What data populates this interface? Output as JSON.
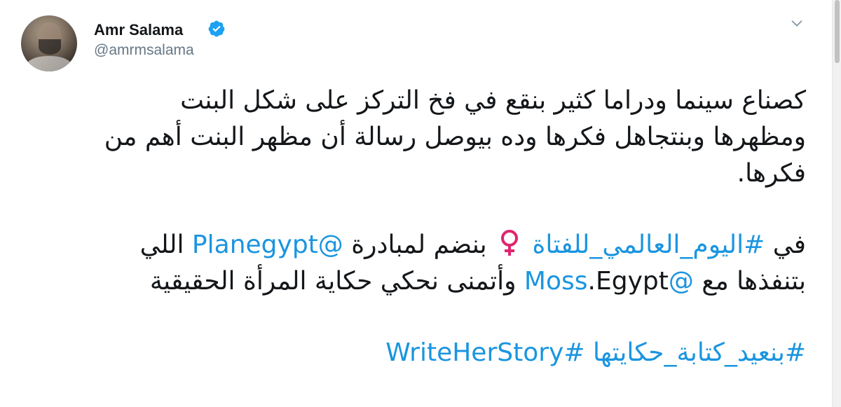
{
  "tweet": {
    "author": {
      "display_name": "Amr Salama",
      "handle": "@amrmsalama",
      "verified": true,
      "avatar_icon": "avatar-photo"
    },
    "menu_icon": "chevron-down-icon",
    "paragraph1_line1": "كصناع سينما ودراما كثير بنقع في فخ التركز على شكل البنت",
    "paragraph1_line2": "ومظهرها وبنتجاهل فكرها وده بيوصل رسالة أن مظهر البنت أهم من",
    "paragraph1_line3": "فكرها.",
    "p2_in": "في",
    "p2_hashtag": "#اليوم_العالمي_للفتاة",
    "p2_mid": "بنضم لمبادرة",
    "p2_mention": "@Planegypt",
    "p2_end": "اللي",
    "p3_start": "بتنفذها مع",
    "p3_mention": "@Moss",
    "p3_rest": ".Egypt وأتمنى نحكي حكاية المرأة الحقيقية",
    "p4_hashtag": "#بنعيد_كتابة_حكايتها",
    "p4_hashtag_en": "#WriteHerStory",
    "colors": {
      "link": "#1b95e0",
      "text": "#14171a",
      "handle": "#657786",
      "venus_pink": "#e0246f"
    }
  }
}
